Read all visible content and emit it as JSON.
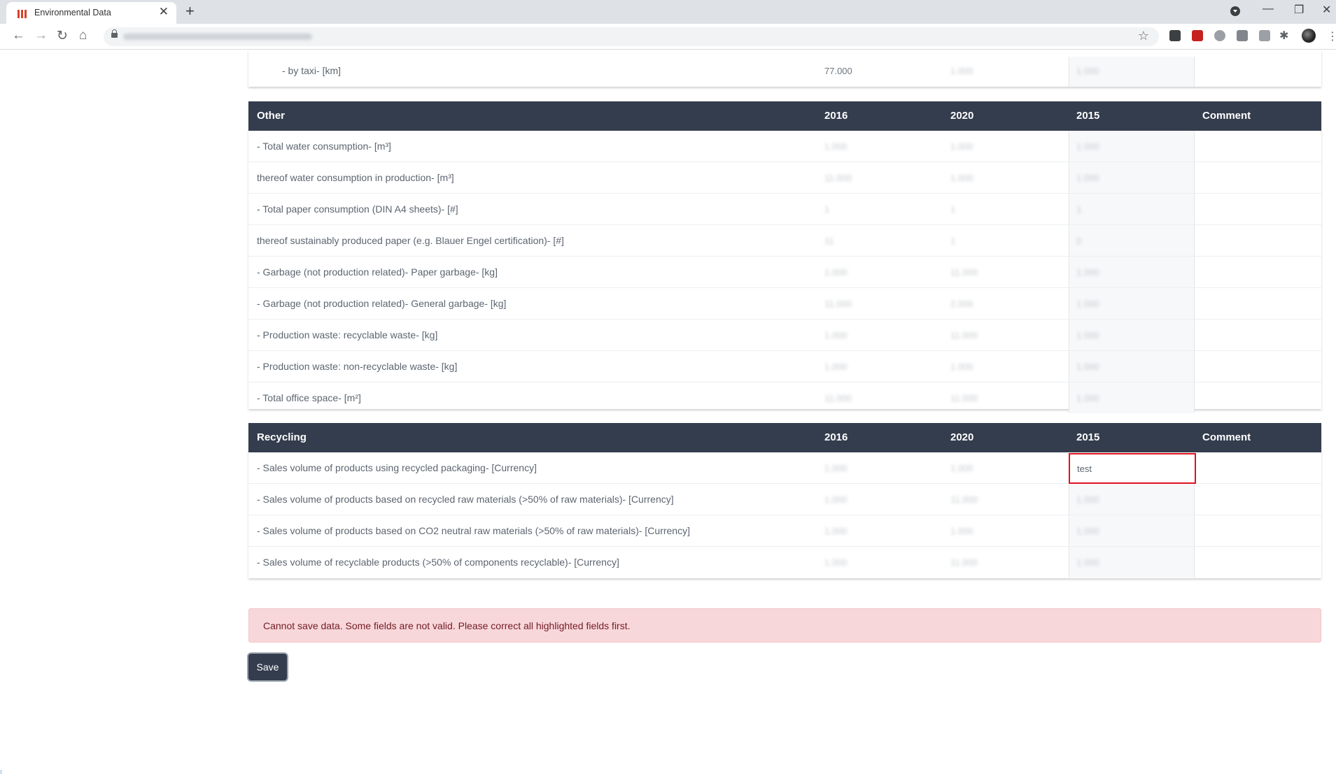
{
  "browser": {
    "tab_title": "Environmental Data",
    "new_tab": "+",
    "close_tab": "✕",
    "star": "☆",
    "window_min": "—",
    "window_restore": "❐",
    "window_close": "✕"
  },
  "taxi_row": {
    "label": "- by taxi- [km]",
    "v2016": "77.000",
    "v2020": "1.000",
    "v2015": "1.000"
  },
  "other": {
    "header": {
      "col0": "Other",
      "col1": "2016",
      "col2": "2020",
      "col3": "2015",
      "col4": "Comment"
    },
    "rows": [
      {
        "label": "- Total water consumption- [m³]",
        "v2016": "1.000",
        "v2020": "1.000",
        "v2015": "1.000"
      },
      {
        "label": "thereof water consumption in production- [m³]",
        "v2016": "11.000",
        "v2020": "1.000",
        "v2015": "1.000"
      },
      {
        "label": "- Total paper consumption (DIN A4 sheets)- [#]",
        "v2016": "1",
        "v2020": "1",
        "v2015": "1"
      },
      {
        "label": "thereof sustainably produced paper (e.g. Blauer Engel certification)- [#]",
        "v2016": "11",
        "v2020": "1",
        "v2015": "0"
      },
      {
        "label": "- Garbage (not production related)- Paper garbage- [kg]",
        "v2016": "1.000",
        "v2020": "11.000",
        "v2015": "1.000"
      },
      {
        "label": "- Garbage (not production related)- General garbage- [kg]",
        "v2016": "11.000",
        "v2020": "2.000",
        "v2015": "1.000"
      },
      {
        "label": "- Production waste: recyclable waste- [kg]",
        "v2016": "1.000",
        "v2020": "11.000",
        "v2015": "1.000"
      },
      {
        "label": "- Production waste: non-recyclable waste- [kg]",
        "v2016": "1.000",
        "v2020": "1.000",
        "v2015": "1.000"
      },
      {
        "label": "- Total office space- [m²]",
        "v2016": "11.000",
        "v2020": "11.000",
        "v2015": "1.000"
      }
    ]
  },
  "recycling": {
    "header": {
      "col0": "Recycling",
      "col1": "2016",
      "col2": "2020",
      "col3": "2015",
      "col4": "Comment"
    },
    "rows": [
      {
        "label": "- Sales volume of products using recycled packaging- [Currency]",
        "v2016": "1.000",
        "v2020": "1.000",
        "v2015": "test"
      },
      {
        "label": "- Sales volume of products based on recycled raw materials (>50% of raw materials)- [Currency]",
        "v2016": "1.000",
        "v2020": "11.000",
        "v2015": "1.000"
      },
      {
        "label": "- Sales volume of products based on CO2 neutral raw materials (>50% of raw materials)- [Currency]",
        "v2016": "1.000",
        "v2020": "1.000",
        "v2015": "1.000"
      },
      {
        "label": "- Sales volume of recyclable products (>50% of components recyclable)- [Currency]",
        "v2016": "1.000",
        "v2020": "11.000",
        "v2015": "1.000"
      }
    ]
  },
  "alert": {
    "message": "Cannot save data. Some fields are not valid. Please correct all highlighted fields first."
  },
  "save_label": "Save",
  "colors": {
    "header_bg": "#343d4d",
    "alert_bg": "#f8d7da",
    "invalid_border": "#e0111f"
  }
}
